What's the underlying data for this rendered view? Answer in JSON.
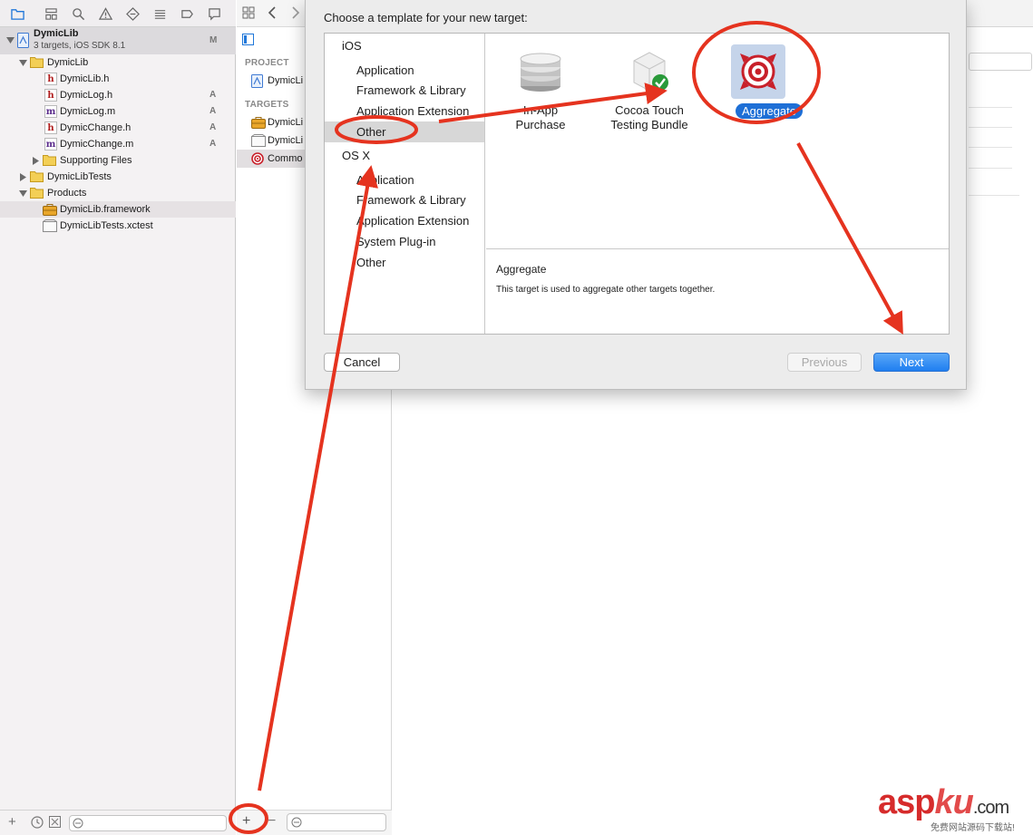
{
  "navigator": {
    "project": {
      "name": "DymicLib",
      "subtitle": "3 targets, iOS SDK 8.1",
      "badge": "M"
    },
    "items": [
      {
        "label": "DymicLib",
        "kind": "folder",
        "badge": ""
      },
      {
        "label": "DymicLib.h",
        "kind": "h",
        "badge": ""
      },
      {
        "label": "DymicLog.h",
        "kind": "h",
        "badge": "A"
      },
      {
        "label": "DymicLog.m",
        "kind": "m",
        "badge": "A"
      },
      {
        "label": "DymicChange.h",
        "kind": "h",
        "badge": "A"
      },
      {
        "label": "DymicChange.m",
        "kind": "m",
        "badge": "A"
      },
      {
        "label": "Supporting Files",
        "kind": "folder",
        "badge": ""
      },
      {
        "label": "DymicLibTests",
        "kind": "folder",
        "badge": ""
      },
      {
        "label": "Products",
        "kind": "folder",
        "badge": ""
      },
      {
        "label": "DymicLib.framework",
        "kind": "framework",
        "badge": ""
      },
      {
        "label": "DymicLibTests.xctest",
        "kind": "xctest",
        "badge": ""
      }
    ],
    "file_letters": {
      "h": "h",
      "m": "m"
    }
  },
  "target_list": {
    "project_header": "PROJECT",
    "project_item": "DymicLi",
    "targets_header": "TARGETS",
    "targets": [
      "DymicLi",
      "DymicLi",
      "Commo"
    ]
  },
  "sheet": {
    "title": "Choose a template for your new target:",
    "ios_label": "iOS",
    "osx_label": "OS X",
    "ios_categories": [
      "Application",
      "Framework & Library",
      "Application Extension",
      "Other"
    ],
    "osx_categories": [
      "Application",
      "Framework & Library",
      "Application Extension",
      "System Plug-in",
      "Other"
    ],
    "templates": [
      {
        "line1": "In-App",
        "line2": "Purchase"
      },
      {
        "line1": "Cocoa Touch",
        "line2": "Testing Bundle"
      },
      {
        "line1": "Aggregate",
        "line2": ""
      }
    ],
    "description_title": "Aggregate",
    "description_text": "This target is used to aggregate other targets together.",
    "buttons": {
      "cancel": "Cancel",
      "previous": "Previous",
      "next": "Next"
    }
  },
  "bottom_bar": {
    "add_symbol": "+",
    "remove_symbol": "−"
  },
  "watermark": {
    "main_a": "asp",
    "main_b": "ku",
    "main_c": ".com",
    "sub": "免费网站源码下载站!"
  },
  "colors": {
    "annotation_red": "#e5331f",
    "selection_blue": "#1e6fd6",
    "aggregate_red": "#c8202a"
  }
}
